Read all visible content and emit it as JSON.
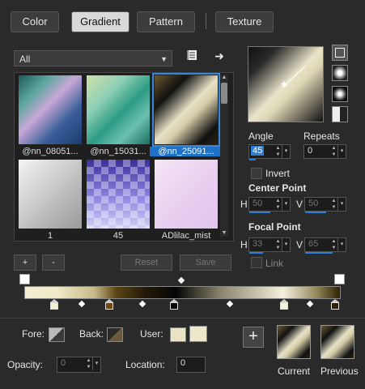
{
  "tabs": [
    {
      "label": "Color"
    },
    {
      "label": "Gradient"
    },
    {
      "label": "Pattern"
    },
    {
      "label": "Texture"
    }
  ],
  "library": {
    "filter_value": "All",
    "swatches": [
      {
        "label": "@nn_08051..."
      },
      {
        "label": "@nn_15031..."
      },
      {
        "label": "@nn_25091..."
      },
      {
        "label": "1"
      },
      {
        "label": "45"
      },
      {
        "label": "ADlilac_mist"
      }
    ]
  },
  "buttons": {
    "add": "+",
    "remove": "-",
    "reset": "Reset",
    "save": "Save"
  },
  "angle": {
    "label": "Angle",
    "value": "45"
  },
  "repeats": {
    "label": "Repeats",
    "value": "0"
  },
  "invert": {
    "label": "Invert",
    "checked": false
  },
  "center_point": {
    "label": "Center Point",
    "h_label": "H",
    "h": "50",
    "v_label": "V",
    "v": "50"
  },
  "focal_point": {
    "label": "Focal Point",
    "h_label": "H",
    "h": "33",
    "v_label": "V",
    "v": "65"
  },
  "link": {
    "label": "Link"
  },
  "bottom": {
    "fore_label": "Fore:",
    "back_label": "Back:",
    "user_label": "User:",
    "opacity_label": "Opacity:",
    "opacity_value": "0",
    "location_label": "Location:",
    "location_value": "0",
    "add_label": "+",
    "current_label": "Current",
    "previous_label": "Previous"
  },
  "icons": {
    "library_menu": "book-icon",
    "export": "arrow-right-icon"
  },
  "colors": {
    "accent": "#2d7fd4",
    "background": "#2a2a2a"
  }
}
